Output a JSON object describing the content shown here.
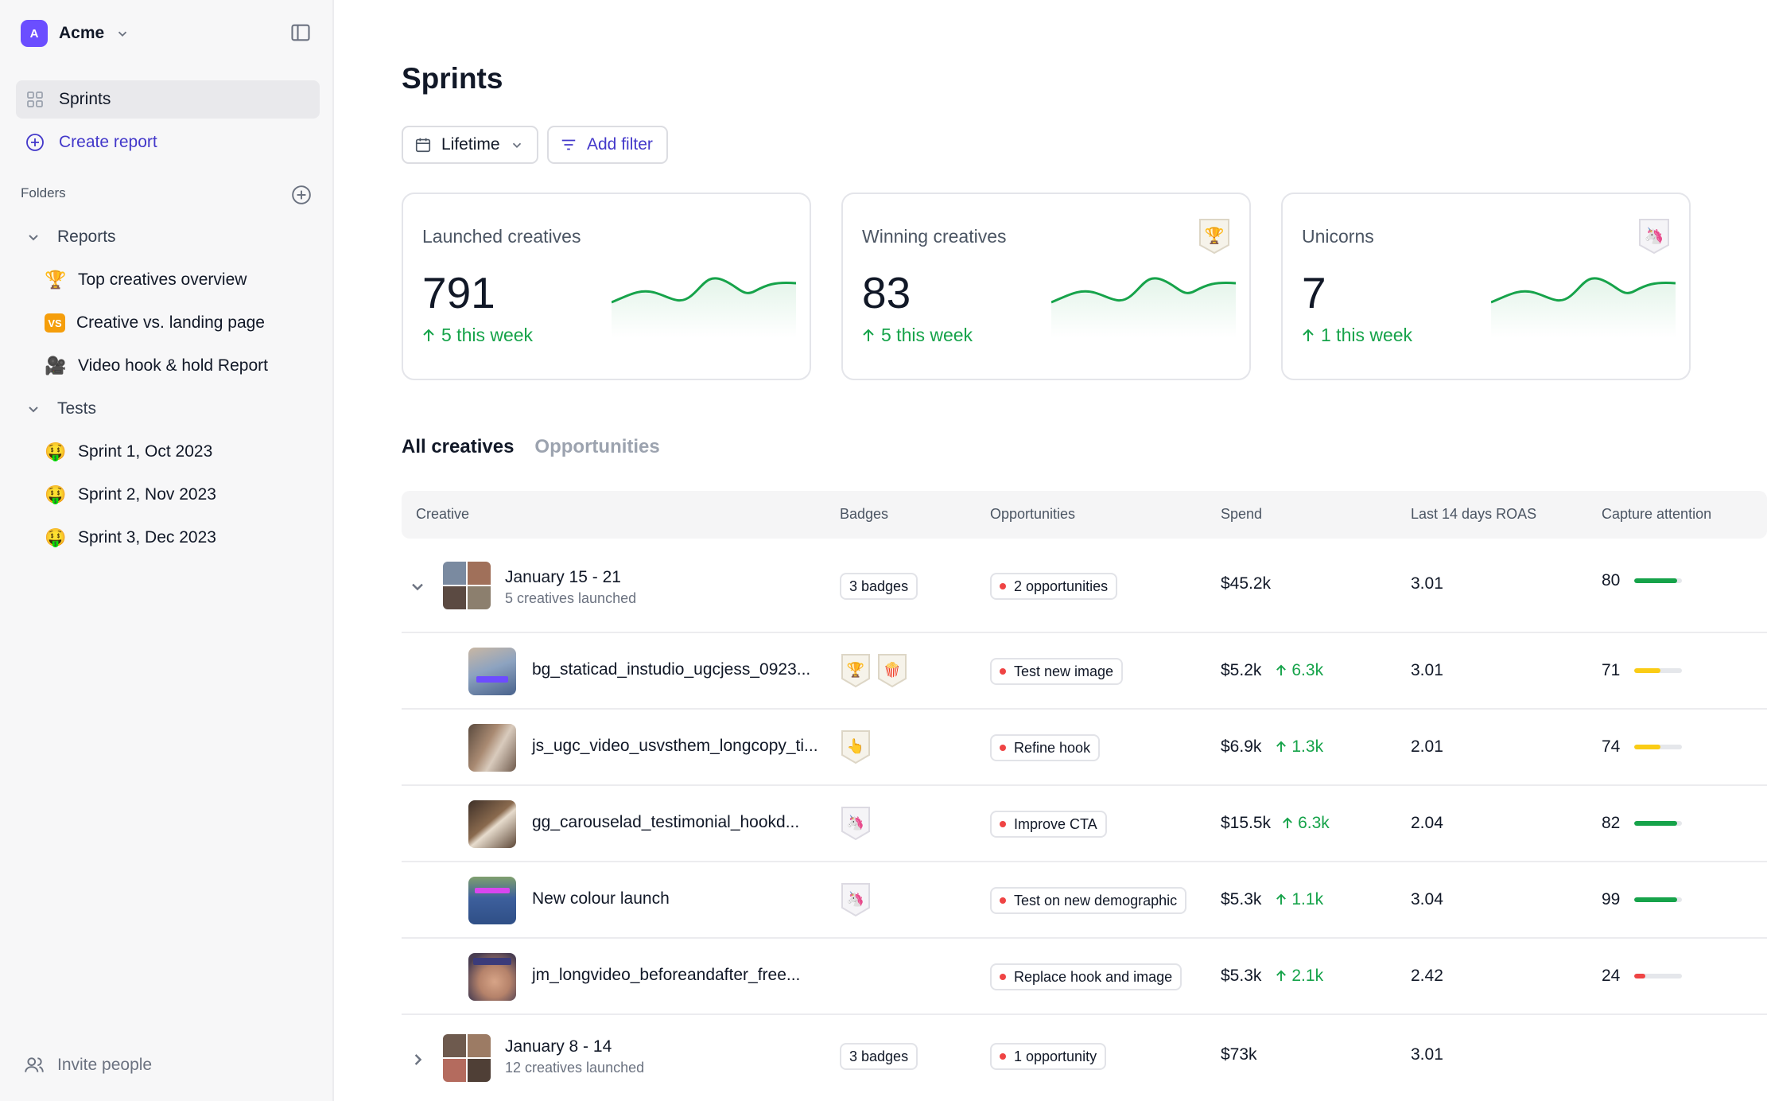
{
  "sidebar": {
    "workspace": {
      "initial": "A",
      "name": "Acme"
    },
    "nav": {
      "sprints": "Sprints",
      "create_report": "Create report"
    },
    "folders_label": "Folders",
    "groups": [
      {
        "label": "Reports",
        "items": [
          {
            "icon": "trophy",
            "label": "Top creatives overview"
          },
          {
            "icon": "vs",
            "label": "Creative vs. landing page"
          },
          {
            "icon": "video-camera",
            "label": "Video hook & hold Report"
          }
        ]
      },
      {
        "label": "Tests",
        "items": [
          {
            "icon": "money-mouth-face",
            "label": "Sprint 1, Oct 2023"
          },
          {
            "icon": "money-mouth-face",
            "label": "Sprint 2, Nov 2023"
          },
          {
            "icon": "money-mouth-face",
            "label": "Sprint 3, Dec 2023"
          }
        ]
      }
    ],
    "vs_text": "VS",
    "invite": "Invite people"
  },
  "main": {
    "title": "Sprints",
    "date_filter": "Lifetime",
    "add_filter": "Add filter",
    "cards": [
      {
        "label": "Launched creatives",
        "value": "791",
        "delta": "5 this week",
        "badge": null
      },
      {
        "label": "Winning creatives",
        "value": "83",
        "delta": "5 this week",
        "badge": "trophy"
      },
      {
        "label": "Unicorns",
        "value": "7",
        "delta": "1 this week",
        "badge": "unicorn"
      }
    ],
    "tabs": {
      "all": "All creatives",
      "opportunities": "Opportunities"
    },
    "columns": {
      "creative": "Creative",
      "badges": "Badges",
      "opportunities": "Opportunities",
      "spend": "Spend",
      "roas": "Last 14 days ROAS",
      "attention": "Capture attention"
    },
    "groups": [
      {
        "title": "January 15 - 21",
        "subtitle": "5 creatives launched",
        "badges": "3 badges",
        "opportunities": "2 opportunities",
        "spend": "$45.2k",
        "roas": "3.01",
        "attention": "80",
        "attention_pct": 0.9,
        "expanded": true
      },
      {
        "title": "January 8 - 14",
        "subtitle": "12 creatives launched",
        "badges": "3 badges",
        "opportunities": "1 opportunity",
        "spend": "$73k",
        "roas": "3.01",
        "expanded": false
      }
    ],
    "creatives": [
      {
        "name": "bg_staticad_instudio_ugcjess_0923...",
        "badges": [
          "trophy",
          "popcorn"
        ],
        "opportunity": "Test new image",
        "spend": "$5.2k",
        "delta": "6.3k",
        "roas": "3.01",
        "attention": "71",
        "attention_pct": 0.55,
        "attention_color": "#facc15"
      },
      {
        "name": "js_ugc_video_usvsthem_longcopy_ti...",
        "badges": [
          "pointing-hand"
        ],
        "opportunity": "Refine hook",
        "spend": "$6.9k",
        "delta": "1.3k",
        "roas": "2.01",
        "attention": "74",
        "attention_pct": 0.55,
        "attention_color": "#facc15"
      },
      {
        "name": "gg_carouselad_testimonial_hookd...",
        "badges": [
          "unicorn"
        ],
        "opportunity": "Improve CTA",
        "spend": "$15.5k",
        "delta": "6.3k",
        "roas": "2.04",
        "attention": "82",
        "attention_pct": 0.9,
        "attention_color": "#16a34a"
      },
      {
        "name": "New colour launch",
        "badges": [
          "unicorn"
        ],
        "opportunity": "Test on new demographic",
        "spend": "$5.3k",
        "delta": "1.1k",
        "roas": "3.04",
        "attention": "99",
        "attention_pct": 0.9,
        "attention_color": "#16a34a"
      },
      {
        "name": "jm_longvideo_beforeandafter_free...",
        "badges": [],
        "opportunity": "Replace hook and image",
        "spend": "$5.3k",
        "delta": "2.1k",
        "roas": "2.42",
        "attention": "24",
        "attention_pct": 0.22,
        "attention_color": "#ef4444"
      }
    ]
  },
  "colors": {
    "accent": "#4338ca",
    "positive": "#16a34a",
    "workspace": "#6b4eff"
  }
}
